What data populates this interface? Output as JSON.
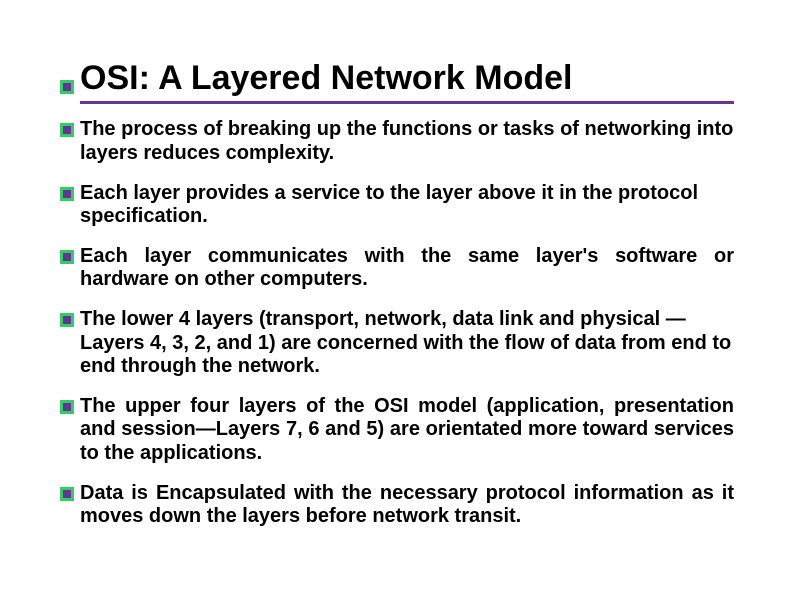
{
  "slide": {
    "title": "OSI: A Layered Network Model",
    "bullets": [
      {
        "text": "The process of breaking up the functions or tasks of networking into layers reduces complexity.",
        "justify": false
      },
      {
        "text": "Each layer provides a service to the layer above it in the protocol specification.",
        "justify": false
      },
      {
        "text": " Each layer communicates with the same layer's software or hardware on other computers.",
        "justify": true
      },
      {
        "text": "The lower 4 layers (transport, network, data link and physical —Layers 4, 3, 2, and 1) are concerned with the flow of data from end to end through the network.",
        "justify": false
      },
      {
        "text": "The upper four layers of the OSI model (application, presentation and session—Layers 7, 6 and 5) are orientated more toward services to the applications.",
        "justify": true
      },
      {
        "text": "Data is Encapsulated with the necessary protocol information as it moves down the layers before network transit.",
        "justify": true
      }
    ]
  }
}
